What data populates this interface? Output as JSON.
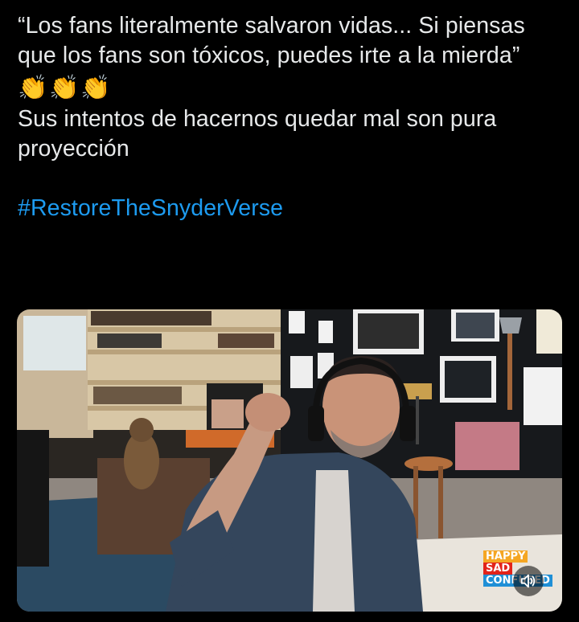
{
  "tweet": {
    "quote_line": "“Los fans literalmente salvaron vidas... Si piensas que los fans son tóxicos, puedes irte a la mierda”",
    "emojis": [
      "👏",
      "👏",
      "👏"
    ],
    "body_line": "Sus intentos de hacernos quedar mal son pura proyección",
    "hashtag": "#RestoreTheSnyderVerse"
  },
  "video": {
    "watermark": {
      "line1": "HAPPY",
      "line2": "SAD",
      "line3": "CONFUSED"
    },
    "mute_icon": "speaker-volume-icon"
  },
  "colors": {
    "background": "#000000",
    "text": "#e7e9ea",
    "link": "#1d9bf0"
  }
}
